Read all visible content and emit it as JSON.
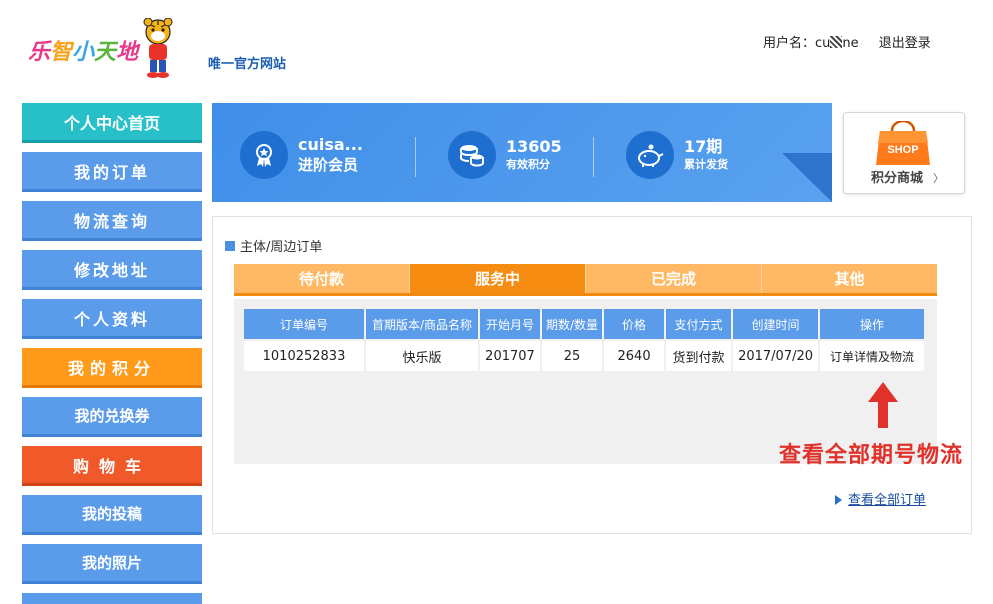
{
  "header": {
    "logo_text": [
      "乐",
      "智",
      "小",
      "天",
      "地"
    ],
    "slogan": "唯一官方网站",
    "user_label": "用户名：cu",
    "user_name_end": "ne",
    "logout": "退出登录"
  },
  "sidebar": {
    "items": [
      {
        "label": "个人中心首页"
      },
      {
        "label": "我的订单"
      },
      {
        "label": "物流查询"
      },
      {
        "label": "修改地址"
      },
      {
        "label": "个人资料"
      },
      {
        "label": "我的积分"
      },
      {
        "label": "我的兑换券"
      },
      {
        "label": "购物车"
      },
      {
        "label": "我的投稿"
      },
      {
        "label": "我的照片"
      }
    ]
  },
  "stats": {
    "member_name": "cuisa...",
    "member_level": "进阶会员",
    "points_value": "13605",
    "points_label": "有效积分",
    "issues_value": "17期",
    "issues_label": "累计发货"
  },
  "shop": {
    "bag_text": "SHOP",
    "label": "积分商城",
    "chevron": "〉"
  },
  "orders": {
    "section_title": "主体/周边订单",
    "tabs": [
      "待付款",
      "服务中",
      "已完成",
      "其他"
    ],
    "active_tab": 1,
    "columns": [
      "订单编号",
      "首期版本/商品名称",
      "开始月号",
      "期数/数量",
      "价格",
      "支付方式",
      "创建时间",
      "操作"
    ],
    "rows": [
      [
        "1010252833",
        "快乐版",
        "201707",
        "25",
        "2640",
        "货到付款",
        "2017/07/20",
        "订单详情及物流"
      ]
    ],
    "annotation": "查看全部期号物流",
    "view_all": "查看全部订单"
  },
  "colors": {
    "primary_blue": "#5a9bea",
    "teal": "#28c0c8",
    "orange": "#ff9a1a",
    "red_orange": "#f05a2a",
    "annotation_red": "#e0312a"
  }
}
